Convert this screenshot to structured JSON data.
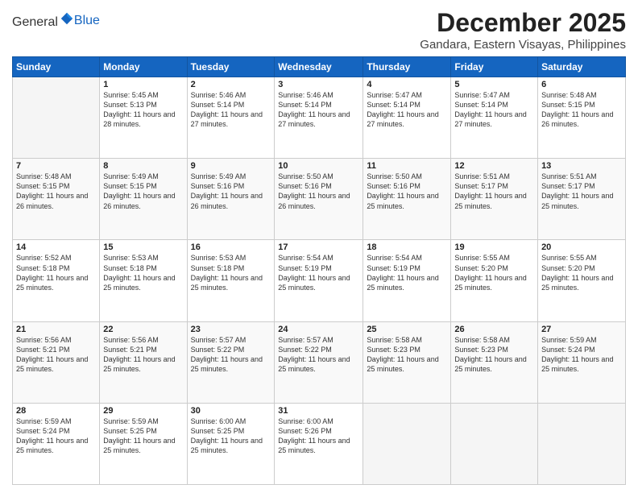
{
  "logo": {
    "general": "General",
    "blue": "Blue"
  },
  "title": "December 2025",
  "location": "Gandara, Eastern Visayas, Philippines",
  "weekdays": [
    "Sunday",
    "Monday",
    "Tuesday",
    "Wednesday",
    "Thursday",
    "Friday",
    "Saturday"
  ],
  "weeks": [
    [
      {
        "day": "",
        "empty": true
      },
      {
        "day": "1",
        "sunrise": "Sunrise: 5:45 AM",
        "sunset": "Sunset: 5:13 PM",
        "daylight": "Daylight: 11 hours and 28 minutes."
      },
      {
        "day": "2",
        "sunrise": "Sunrise: 5:46 AM",
        "sunset": "Sunset: 5:14 PM",
        "daylight": "Daylight: 11 hours and 27 minutes."
      },
      {
        "day": "3",
        "sunrise": "Sunrise: 5:46 AM",
        "sunset": "Sunset: 5:14 PM",
        "daylight": "Daylight: 11 hours and 27 minutes."
      },
      {
        "day": "4",
        "sunrise": "Sunrise: 5:47 AM",
        "sunset": "Sunset: 5:14 PM",
        "daylight": "Daylight: 11 hours and 27 minutes."
      },
      {
        "day": "5",
        "sunrise": "Sunrise: 5:47 AM",
        "sunset": "Sunset: 5:14 PM",
        "daylight": "Daylight: 11 hours and 27 minutes."
      },
      {
        "day": "6",
        "sunrise": "Sunrise: 5:48 AM",
        "sunset": "Sunset: 5:15 PM",
        "daylight": "Daylight: 11 hours and 26 minutes."
      }
    ],
    [
      {
        "day": "7",
        "sunrise": "Sunrise: 5:48 AM",
        "sunset": "Sunset: 5:15 PM",
        "daylight": "Daylight: 11 hours and 26 minutes."
      },
      {
        "day": "8",
        "sunrise": "Sunrise: 5:49 AM",
        "sunset": "Sunset: 5:15 PM",
        "daylight": "Daylight: 11 hours and 26 minutes."
      },
      {
        "day": "9",
        "sunrise": "Sunrise: 5:49 AM",
        "sunset": "Sunset: 5:16 PM",
        "daylight": "Daylight: 11 hours and 26 minutes."
      },
      {
        "day": "10",
        "sunrise": "Sunrise: 5:50 AM",
        "sunset": "Sunset: 5:16 PM",
        "daylight": "Daylight: 11 hours and 26 minutes."
      },
      {
        "day": "11",
        "sunrise": "Sunrise: 5:50 AM",
        "sunset": "Sunset: 5:16 PM",
        "daylight": "Daylight: 11 hours and 25 minutes."
      },
      {
        "day": "12",
        "sunrise": "Sunrise: 5:51 AM",
        "sunset": "Sunset: 5:17 PM",
        "daylight": "Daylight: 11 hours and 25 minutes."
      },
      {
        "day": "13",
        "sunrise": "Sunrise: 5:51 AM",
        "sunset": "Sunset: 5:17 PM",
        "daylight": "Daylight: 11 hours and 25 minutes."
      }
    ],
    [
      {
        "day": "14",
        "sunrise": "Sunrise: 5:52 AM",
        "sunset": "Sunset: 5:18 PM",
        "daylight": "Daylight: 11 hours and 25 minutes."
      },
      {
        "day": "15",
        "sunrise": "Sunrise: 5:53 AM",
        "sunset": "Sunset: 5:18 PM",
        "daylight": "Daylight: 11 hours and 25 minutes."
      },
      {
        "day": "16",
        "sunrise": "Sunrise: 5:53 AM",
        "sunset": "Sunset: 5:18 PM",
        "daylight": "Daylight: 11 hours and 25 minutes."
      },
      {
        "day": "17",
        "sunrise": "Sunrise: 5:54 AM",
        "sunset": "Sunset: 5:19 PM",
        "daylight": "Daylight: 11 hours and 25 minutes."
      },
      {
        "day": "18",
        "sunrise": "Sunrise: 5:54 AM",
        "sunset": "Sunset: 5:19 PM",
        "daylight": "Daylight: 11 hours and 25 minutes."
      },
      {
        "day": "19",
        "sunrise": "Sunrise: 5:55 AM",
        "sunset": "Sunset: 5:20 PM",
        "daylight": "Daylight: 11 hours and 25 minutes."
      },
      {
        "day": "20",
        "sunrise": "Sunrise: 5:55 AM",
        "sunset": "Sunset: 5:20 PM",
        "daylight": "Daylight: 11 hours and 25 minutes."
      }
    ],
    [
      {
        "day": "21",
        "sunrise": "Sunrise: 5:56 AM",
        "sunset": "Sunset: 5:21 PM",
        "daylight": "Daylight: 11 hours and 25 minutes."
      },
      {
        "day": "22",
        "sunrise": "Sunrise: 5:56 AM",
        "sunset": "Sunset: 5:21 PM",
        "daylight": "Daylight: 11 hours and 25 minutes."
      },
      {
        "day": "23",
        "sunrise": "Sunrise: 5:57 AM",
        "sunset": "Sunset: 5:22 PM",
        "daylight": "Daylight: 11 hours and 25 minutes."
      },
      {
        "day": "24",
        "sunrise": "Sunrise: 5:57 AM",
        "sunset": "Sunset: 5:22 PM",
        "daylight": "Daylight: 11 hours and 25 minutes."
      },
      {
        "day": "25",
        "sunrise": "Sunrise: 5:58 AM",
        "sunset": "Sunset: 5:23 PM",
        "daylight": "Daylight: 11 hours and 25 minutes."
      },
      {
        "day": "26",
        "sunrise": "Sunrise: 5:58 AM",
        "sunset": "Sunset: 5:23 PM",
        "daylight": "Daylight: 11 hours and 25 minutes."
      },
      {
        "day": "27",
        "sunrise": "Sunrise: 5:59 AM",
        "sunset": "Sunset: 5:24 PM",
        "daylight": "Daylight: 11 hours and 25 minutes."
      }
    ],
    [
      {
        "day": "28",
        "sunrise": "Sunrise: 5:59 AM",
        "sunset": "Sunset: 5:24 PM",
        "daylight": "Daylight: 11 hours and 25 minutes."
      },
      {
        "day": "29",
        "sunrise": "Sunrise: 5:59 AM",
        "sunset": "Sunset: 5:25 PM",
        "daylight": "Daylight: 11 hours and 25 minutes."
      },
      {
        "day": "30",
        "sunrise": "Sunrise: 6:00 AM",
        "sunset": "Sunset: 5:25 PM",
        "daylight": "Daylight: 11 hours and 25 minutes."
      },
      {
        "day": "31",
        "sunrise": "Sunrise: 6:00 AM",
        "sunset": "Sunset: 5:26 PM",
        "daylight": "Daylight: 11 hours and 25 minutes."
      },
      {
        "day": "",
        "empty": true
      },
      {
        "day": "",
        "empty": true
      },
      {
        "day": "",
        "empty": true
      }
    ]
  ]
}
